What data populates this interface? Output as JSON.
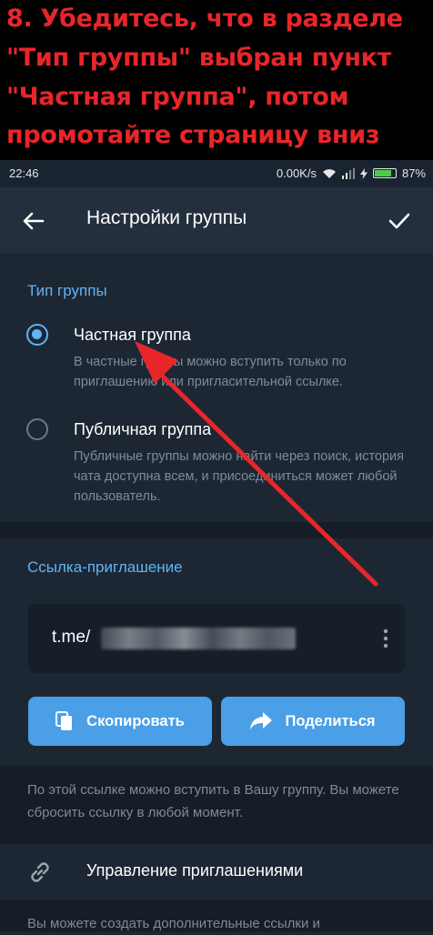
{
  "banner": {
    "line1": "8. Убедитесь, что в разделе",
    "line2": "\"Тип группы\" выбран пункт",
    "line3": "\"Частная группа\", потом",
    "line4": "промотайте страницу вниз"
  },
  "status": {
    "time": "22:46",
    "speed": "0.00K/s",
    "battery": "87%",
    "battery_level": 0.87
  },
  "appbar": {
    "title": "Настройки группы"
  },
  "group_type": {
    "header": "Тип группы",
    "private": {
      "title": "Частная группа",
      "desc": "В частные группы можно вступить только по приглашению или пригласительной ссылке.",
      "selected": true
    },
    "public": {
      "title": "Публичная группа",
      "desc": "Публичные группы можно найти через поиск, история чата доступна всем, и присоединиться может любой пользователь.",
      "selected": false
    }
  },
  "invite": {
    "header": "Ссылка-приглашение",
    "link_prefix": "t.me/",
    "copy_label": "Скопировать",
    "share_label": "Поделиться",
    "hint": "По этой ссылке можно вступить в Вашу группу. Вы можете сбросить ссылку в любой момент."
  },
  "manage": {
    "label": "Управление приглашениями",
    "hint": "Вы можете создать дополнительные ссылки и"
  },
  "colors": {
    "accent": "#5eb5f7",
    "button": "#4b9fe6",
    "banner_text": "#e8262a",
    "arrow": "#e8262a",
    "background": "#1d2733"
  }
}
